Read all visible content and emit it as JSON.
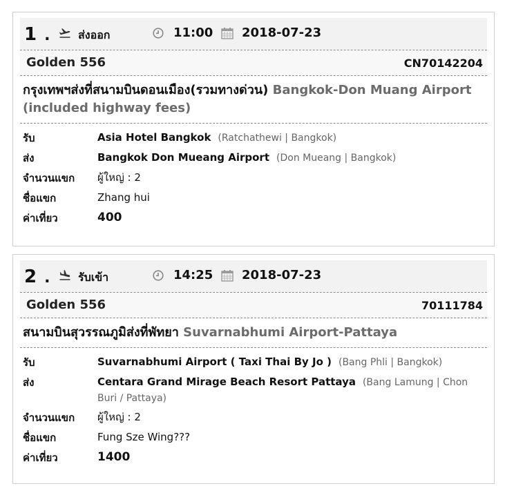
{
  "bookings": [
    {
      "index": "1",
      "index_dot": ".",
      "type": "ส่งออก",
      "time": "11:00",
      "date": "2018-07-23",
      "company": "Golden 556",
      "code": "CN70142204",
      "route_th": "กรุงเทพฯส่งที่สนามบินดอนเมือง(รวมทางด่วน)",
      "route_en": "Bangkok-Don Muang Airport (included highway fees)",
      "pickup_label": "รับ",
      "pickup_place": "Asia Hotel Bangkok",
      "pickup_area": "(Ratchathewi | Bangkok)",
      "dropoff_label": "ส่ง",
      "dropoff_place": "Bangkok Don Mueang Airport",
      "dropoff_area": "(Don Mueang | Bangkok)",
      "pax_label": "จำนวนแขก",
      "pax_value": "ผู้ใหญ่ : 2",
      "guest_label": "ชื่อแขก",
      "guest_value": "Zhang hui",
      "fare_label": "ค่าเที่ยว",
      "fare_value": "400"
    },
    {
      "index": "2",
      "index_dot": ".",
      "type": "รับเข้า",
      "time": "14:25",
      "date": "2018-07-23",
      "company": "Golden 556",
      "code": "70111784",
      "route_th": "สนามบินสุวรรณภูมิส่งที่พัทยา",
      "route_en": "Suvarnabhumi Airport-Pattaya",
      "pickup_label": "รับ",
      "pickup_place": "Suvarnabhumi Airport ( Taxi Thai By Jo )",
      "pickup_area": "(Bang Phli | Bangkok)",
      "dropoff_label": "ส่ง",
      "dropoff_place": "Centara Grand Mirage Beach Resort Pattaya",
      "dropoff_area": "(Bang Lamung | Chon Buri / Pattaya)",
      "pax_label": "จำนวนแขก",
      "pax_value": "ผู้ใหญ่ : 2",
      "guest_label": "ชื่อแขก",
      "guest_value": "Fung Sze Wing???",
      "fare_label": "ค่าเที่ยว",
      "fare_value": "1400"
    }
  ]
}
